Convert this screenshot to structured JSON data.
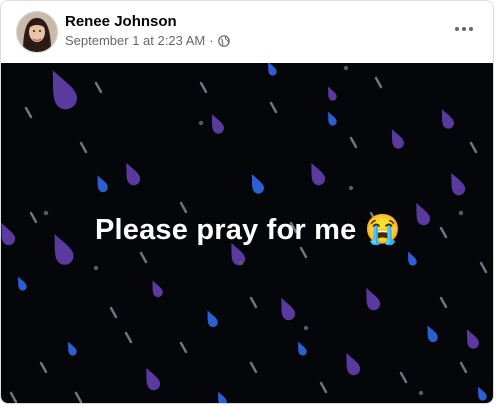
{
  "post": {
    "author": "Renee Johnson",
    "timestamp": "September 1 at 2:23 AM",
    "separator": "·",
    "audience_icon": "globe-icon",
    "more_icon": "more-options-icon",
    "text": "Please pray for me",
    "emoji": "😭",
    "background": "#05060a",
    "drop_colors": [
      "#5b3aa0",
      "#2e5fd0",
      "#9a9aa6"
    ]
  }
}
